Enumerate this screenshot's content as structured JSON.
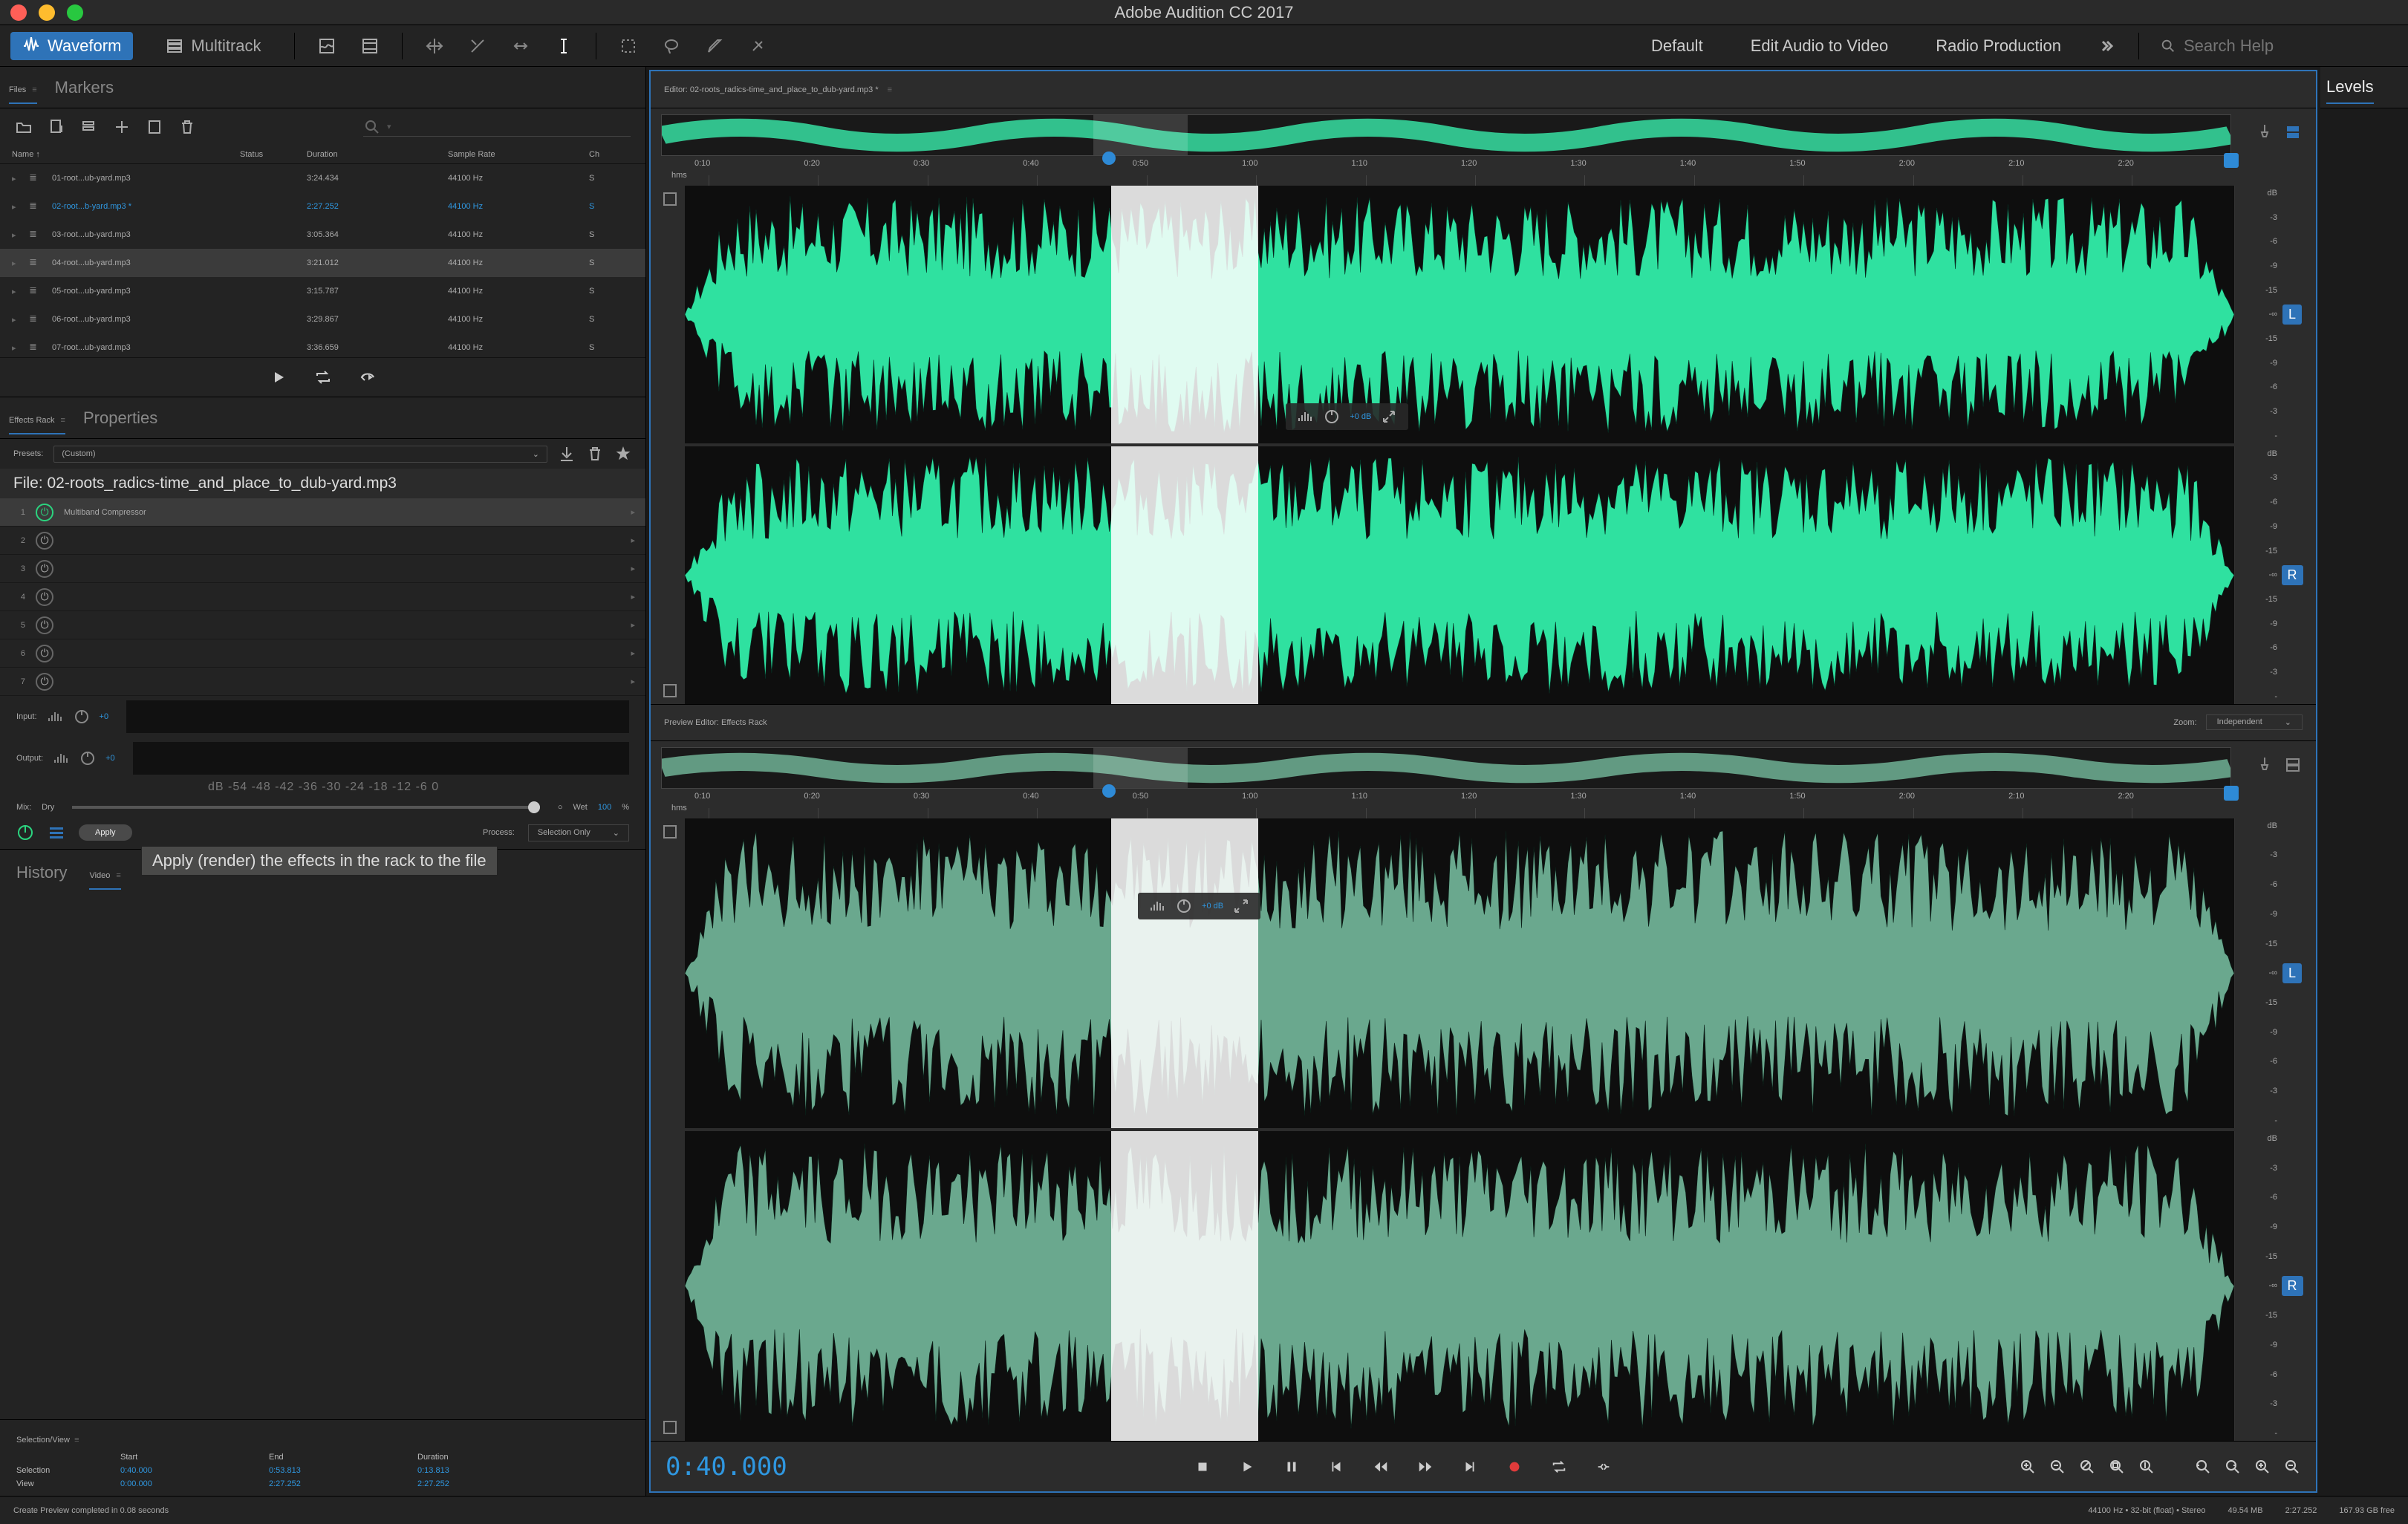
{
  "app_title": "Adobe Audition CC 2017",
  "toolbar": {
    "view_waveform": "Waveform",
    "view_multitrack": "Multitrack",
    "workspaces": [
      "Default",
      "Edit Audio to Video",
      "Radio Production"
    ],
    "search_placeholder": "Search Help"
  },
  "files_panel": {
    "tab_files": "Files",
    "tab_markers": "Markers",
    "col_name": "Name ↑",
    "col_status": "Status",
    "col_duration": "Duration",
    "col_sample_rate": "Sample Rate",
    "col_channels": "Ch",
    "rows": [
      {
        "name": "01-root...ub-yard.mp3",
        "duration": "3:24.434",
        "sr": "44100 Hz",
        "ch": "S"
      },
      {
        "name": "02-root...b-yard.mp3 *",
        "duration": "2:27.252",
        "sr": "44100 Hz",
        "ch": "S",
        "modified": true
      },
      {
        "name": "03-root...ub-yard.mp3",
        "duration": "3:05.364",
        "sr": "44100 Hz",
        "ch": "S"
      },
      {
        "name": "04-root...ub-yard.mp3",
        "duration": "3:21.012",
        "sr": "44100 Hz",
        "ch": "S",
        "selected": true
      },
      {
        "name": "05-root...ub-yard.mp3",
        "duration": "3:15.787",
        "sr": "44100 Hz",
        "ch": "S"
      },
      {
        "name": "06-root...ub-yard.mp3",
        "duration": "3:29.867",
        "sr": "44100 Hz",
        "ch": "S"
      },
      {
        "name": "07-root...ub-yard.mp3",
        "duration": "3:36.659",
        "sr": "44100 Hz",
        "ch": "S"
      }
    ]
  },
  "effects_rack": {
    "tab_rack": "Effects Rack",
    "tab_props": "Properties",
    "presets_label": "Presets:",
    "preset_value": "(Custom)",
    "file_label": "File: 02-roots_radics-time_and_place_to_dub-yard.mp3",
    "slots": [
      {
        "n": "1",
        "name": "Multiband Compressor",
        "on": true
      },
      {
        "n": "2"
      },
      {
        "n": "3"
      },
      {
        "n": "4"
      },
      {
        "n": "5"
      },
      {
        "n": "6"
      },
      {
        "n": "7"
      }
    ],
    "input_label": "Input:",
    "input_val": "+0",
    "output_label": "Output:",
    "output_val": "+0",
    "db_scale": "dB   -54   -48   -42   -36   -30   -24   -18   -12   -6    0",
    "mix_label": "Mix:",
    "dry": "Dry",
    "wet": "Wet",
    "wet_pct": "100",
    "pct_sym": "%",
    "apply": "Apply",
    "process_label": "Process:",
    "process_value": "Selection Only",
    "tooltip": "Apply (render) the effects in the rack to the file"
  },
  "history": {
    "tab_history": "History",
    "tab_video": "Video"
  },
  "selview": {
    "title": "Selection/View",
    "col_start": "Start",
    "col_end": "End",
    "col_dur": "Duration",
    "row_sel": "Selection",
    "sel_start": "0:40.000",
    "sel_end": "0:53.813",
    "sel_dur": "0:13.813",
    "row_view": "View",
    "view_start": "0:00.000",
    "view_end": "2:27.252",
    "view_dur": "2:27.252"
  },
  "editor": {
    "title": "Editor: 02-roots_radics-time_and_place_to_dub-yard.mp3 *",
    "hms": "hms",
    "ticks": [
      "0:10",
      "0:20",
      "0:30",
      "0:40",
      "0:50",
      "1:00",
      "1:10",
      "1:20",
      "1:30",
      "1:40",
      "1:50",
      "2:00",
      "2:10",
      "2:20"
    ],
    "db_ticks": [
      "dB",
      "-3",
      "-6",
      "-9",
      "-15",
      "-∞",
      "-15",
      "-9",
      "-6",
      "-3",
      "-"
    ],
    "hud_db": "+0 dB"
  },
  "preview": {
    "title": "Preview Editor: Effects Rack",
    "zoom_label": "Zoom:",
    "zoom_value": "Independent",
    "hud_db": "+0 dB"
  },
  "transport": {
    "timecode": "0:40.000"
  },
  "levels": {
    "tab": "Levels"
  },
  "status": {
    "msg": "Create Preview completed in 0.08 seconds",
    "sr": "44100 Hz",
    "bits": "32-bit (float)",
    "stereo": "Stereo",
    "size": "49.54 MB",
    "dur": "2:27.252",
    "free": "167.93 GB free"
  }
}
